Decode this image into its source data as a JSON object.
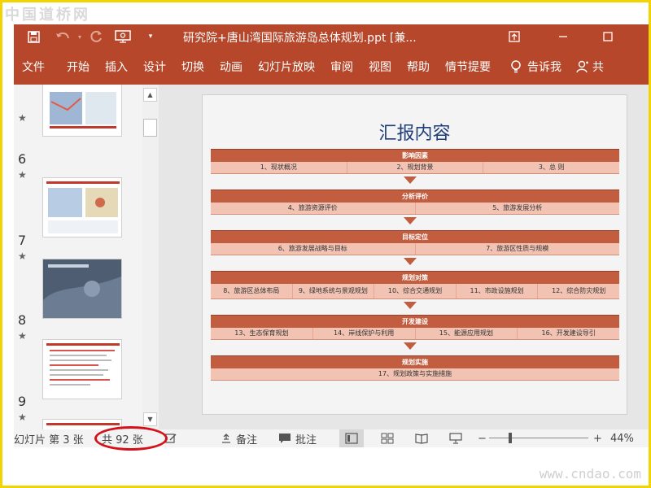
{
  "watermark": {
    "top": "中国道桥网",
    "bottom": "www.cndao.com"
  },
  "titlebar": {
    "title": "研究院+唐山湾国际旅游岛总体规划.ppt [兼...",
    "save_icon": "save-icon",
    "undo_icon": "undo-icon",
    "redo_icon": "redo-icon",
    "present_icon": "present-from-start-icon",
    "customize_icon": "customize-qat-icon"
  },
  "ribbon": {
    "tabs": [
      "文件",
      "开始",
      "插入",
      "设计",
      "切换",
      "动画",
      "幻灯片放映",
      "审阅",
      "视图",
      "帮助",
      "情节提要"
    ],
    "tell_me": "告诉我",
    "share_partial": "共"
  },
  "thumbnails": [
    {
      "num": "",
      "star": "★"
    },
    {
      "num": "6",
      "star": "★"
    },
    {
      "num": "7",
      "star": "★"
    },
    {
      "num": "8",
      "star": "★"
    },
    {
      "num": "9",
      "star": "★"
    }
  ],
  "slide": {
    "title": "汇报内容",
    "sections": [
      {
        "head": "影响因素",
        "items": [
          "1、现状概况",
          "2、规划背景",
          "3、总    则"
        ]
      },
      {
        "head": "分析评价",
        "items": [
          "4、旅游资源评价",
          "5、旅游发展分析"
        ]
      },
      {
        "head": "目标定位",
        "items": [
          "6、旅游发展战略与目标",
          "7、旅游区性质与规模"
        ]
      },
      {
        "head": "规划对策",
        "items": [
          "8、旅游区总体布局",
          "9、绿地系统与景观规划",
          "10、综合交通规划",
          "11、市政设施规划",
          "12、综合防灾规划"
        ]
      },
      {
        "head": "开发建设",
        "items": [
          "13、生态保育规划",
          "14、岸线保护与利用",
          "15、能源应用规划",
          "16、开发建设导引"
        ]
      },
      {
        "head": "规划实施",
        "items": [
          "17、规划政策与实施措施"
        ]
      }
    ]
  },
  "statusbar": {
    "slide_label": "幻灯片 第 3 张",
    "total_label": "共 92 张",
    "notes_label": "备注",
    "comments_label": "批注",
    "zoom": "44%",
    "zoom_minus": "−",
    "zoom_plus": "+"
  },
  "colors": {
    "accent": "#b7472a",
    "section": "#c25d3f",
    "item_bg": "#f2c2b2",
    "title": "#1f3e7a",
    "highlight": "#d4121c"
  }
}
